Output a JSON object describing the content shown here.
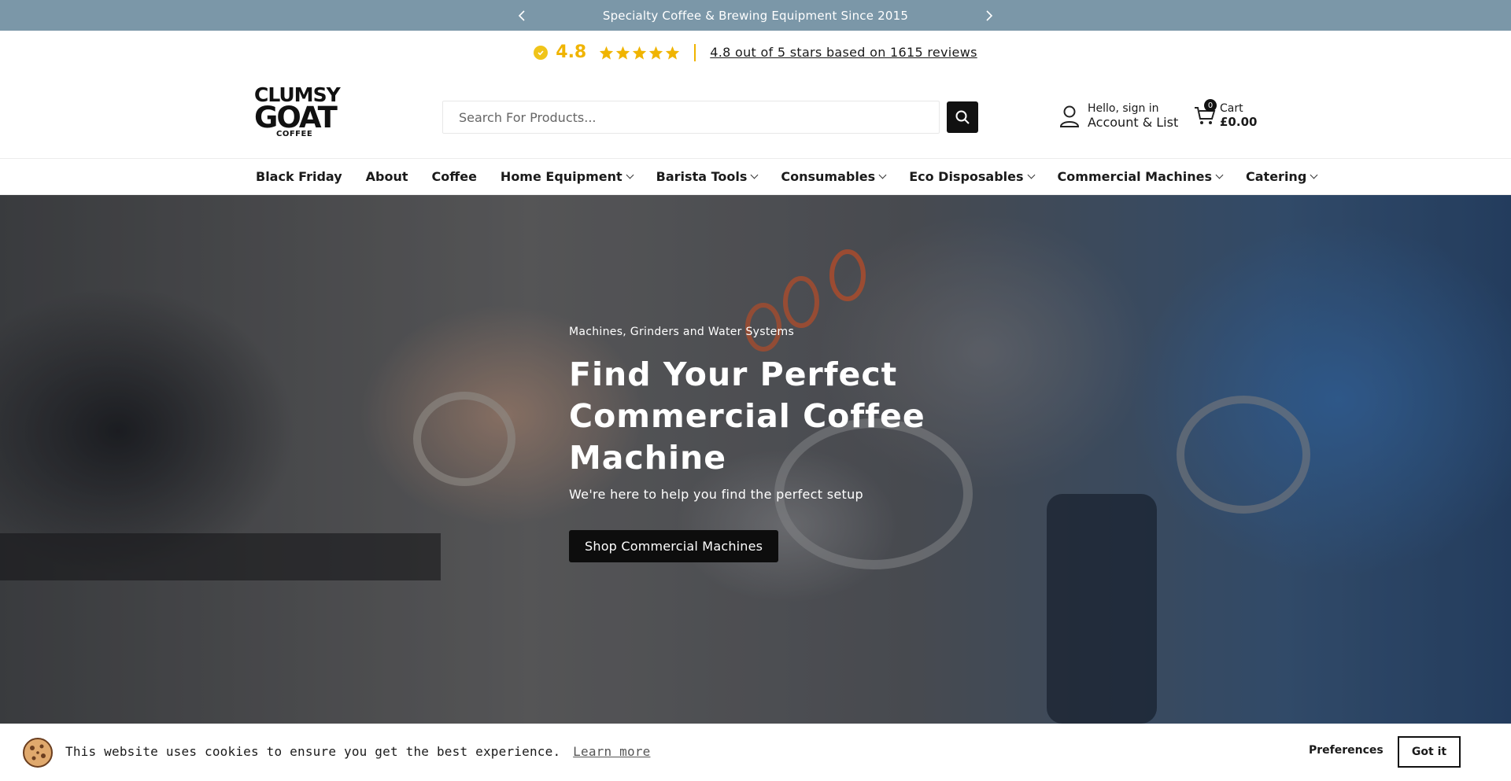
{
  "announcement": {
    "text": "Specialty Coffee & Brewing Equipment Since 2015",
    "prev_icon": "chevron-left-icon",
    "next_icon": "chevron-right-icon"
  },
  "reviews": {
    "score": "4.8",
    "stars": 5,
    "summary": "4.8 out of 5 stars based on 1615 reviews",
    "accent_color": "#f0b400"
  },
  "header": {
    "logo": {
      "line1": "CLUMSY",
      "line2": "GOAT",
      "line3": "COFFEE"
    },
    "search_placeholder": "Search For Products...",
    "account": {
      "greeting": "Hello, sign in",
      "label": "Account & List"
    },
    "cart": {
      "count": "0",
      "label": "Cart",
      "total": "£0.00"
    }
  },
  "nav": {
    "items": [
      {
        "label": "Black Friday",
        "dropdown": false
      },
      {
        "label": "About",
        "dropdown": false
      },
      {
        "label": "Coffee",
        "dropdown": false
      },
      {
        "label": "Home Equipment",
        "dropdown": true
      },
      {
        "label": "Barista Tools",
        "dropdown": true
      },
      {
        "label": "Consumables",
        "dropdown": true
      },
      {
        "label": "Eco Disposables",
        "dropdown": true
      },
      {
        "label": "Commercial Machines",
        "dropdown": true
      },
      {
        "label": "Catering",
        "dropdown": true
      }
    ]
  },
  "hero": {
    "eyebrow": "Machines, Grinders and Water Systems",
    "title": "Find Your Perfect Commercial Coffee Machine",
    "subtitle": "We're here to help you find the perfect setup",
    "cta": "Shop Commercial Machines"
  },
  "cookie": {
    "message": "This website uses cookies to ensure you get the best experience.",
    "learn_more": "Learn more",
    "preferences": "Preferences",
    "accept": "Got it"
  }
}
